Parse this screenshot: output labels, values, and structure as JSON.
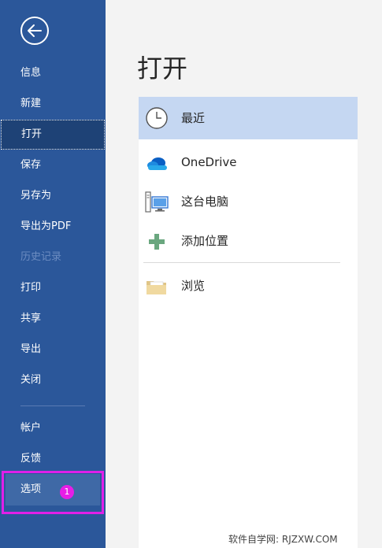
{
  "sidebar": {
    "nav_items": [
      {
        "label": "信息"
      },
      {
        "label": "新建"
      },
      {
        "label": "打开"
      },
      {
        "label": "保存"
      },
      {
        "label": "另存为"
      },
      {
        "label": "导出为PDF"
      },
      {
        "label": "历史记录"
      },
      {
        "label": "打印"
      },
      {
        "label": "共享"
      },
      {
        "label": "导出"
      },
      {
        "label": "关闭"
      }
    ],
    "bottom_items": [
      {
        "label": "帐户"
      },
      {
        "label": "反馈"
      },
      {
        "label": "选项"
      }
    ],
    "selected": "打开",
    "disabled": "历史记录",
    "back_icon": "arrow-left-circle-icon"
  },
  "annotation": {
    "badge": "1",
    "color": "#e020e8"
  },
  "main": {
    "title": "打开",
    "locations": [
      {
        "label": "最近",
        "icon": "clock-icon"
      },
      {
        "label": "OneDrive",
        "icon": "cloud-icon"
      },
      {
        "label": "这台电脑",
        "icon": "computer-icon"
      },
      {
        "label": "添加位置",
        "icon": "plus-icon"
      },
      {
        "label": "浏览",
        "icon": "folder-icon"
      }
    ],
    "selected_location": "最近"
  },
  "watermark": "软件自学网: RJZXW.COM",
  "colors": {
    "sidebar": "#2b579a",
    "selected_nav": "#1e4276",
    "selected_location": "#c5d7f2"
  }
}
